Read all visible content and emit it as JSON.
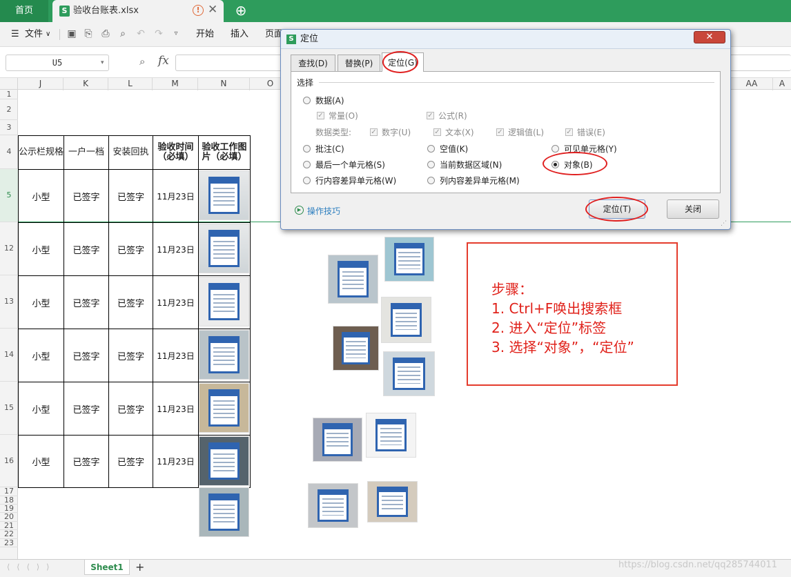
{
  "titlebar": {
    "home_tab": "首页",
    "file_tab": "验收台账表.xlsx",
    "file_icon": "S"
  },
  "menubar": {
    "file_menu": "文件",
    "items": [
      "开始",
      "插入",
      "页面"
    ]
  },
  "formula": {
    "cell_ref": "U5",
    "fx": "fx"
  },
  "columns": [
    "J",
    "K",
    "L",
    "M",
    "N",
    "O",
    "AA",
    "A"
  ],
  "rows": [
    "1",
    "2",
    "3",
    "4",
    "5",
    "12",
    "13",
    "14",
    "15",
    "16",
    "17",
    "18",
    "19",
    "20",
    "21",
    "22",
    "23"
  ],
  "table": {
    "headers": [
      "公示栏规格",
      "一户一档",
      "安装回执",
      "验收时间（必填）",
      "验收工作图片（必填）"
    ],
    "data_rows": [
      [
        "小型",
        "已签字",
        "已签字",
        "11月23日"
      ],
      [
        "小型",
        "已签字",
        "已签字",
        "11月23日"
      ],
      [
        "小型",
        "已签字",
        "已签字",
        "11月23日"
      ],
      [
        "小型",
        "已签字",
        "已签字",
        "11月23日"
      ],
      [
        "小型",
        "已签字",
        "已签字",
        "11月23日"
      ],
      [
        "小型",
        "已签字",
        "已签字",
        "11月23日"
      ]
    ]
  },
  "dialog": {
    "icon": "S",
    "title": "定位",
    "tabs": [
      "查找(D)",
      "替换(P)",
      "定位(G)"
    ],
    "group_label": "选择",
    "opt_data": "数据(A)",
    "chk_constant": "常量(O)",
    "chk_formula": "公式(R)",
    "data_type_label": "数据类型:",
    "chk_types": [
      "数字(U)",
      "文本(X)",
      "逻辑值(L)",
      "错误(E)"
    ],
    "options": [
      [
        "批注(C)",
        "空值(K)",
        "可见单元格(Y)"
      ],
      [
        "最后一个单元格(S)",
        "当前数据区域(N)",
        "对象(B)"
      ],
      [
        "行内容差异单元格(W)",
        "列内容差异单元格(M)"
      ]
    ],
    "selected_option": "对象(B)",
    "tips_link": "操作技巧",
    "ok_button": "定位(T)",
    "close_button": "关闭"
  },
  "note": {
    "lines": [
      "步骤：",
      "1. Ctrl+F唤出搜索框",
      "2. 进入“定位”标签",
      "3. 选择“对象”，“定位”"
    ],
    "color": "#e0211a"
  },
  "sheets": {
    "active": "Sheet1",
    "add": "+"
  },
  "watermark": "https://blog.csdn.net/qq285744011"
}
